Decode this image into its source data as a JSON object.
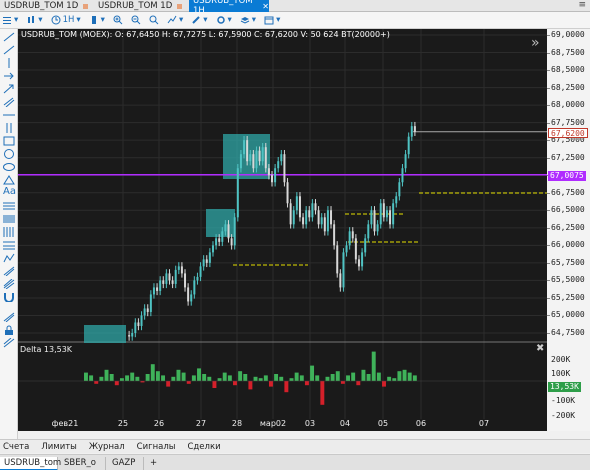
{
  "window_tabs": [
    {
      "label": "USDRUB_TOM 1D",
      "active": false
    },
    {
      "label": "USDRUB_TOM 1D",
      "active": false
    },
    {
      "label": "USDRUB_TOM 1H",
      "active": true
    }
  ],
  "toolbar": {
    "timeframe": "1H"
  },
  "chart": {
    "header": "USDRUB_TOM (MOEX): O: 67,6450 H: 67,7275 L: 67,5900 C: 67,6200 V: 50 624 BT(20000+)",
    "price_axis": [
      "69,0000",
      "68,7500",
      "68,5000",
      "68,2500",
      "68,0000",
      "67,7500",
      "67,5000",
      "67,2500",
      "67,0000",
      "66,7500",
      "66,5000",
      "66,2500",
      "66,0000",
      "65,7500",
      "65,5000",
      "65,2500",
      "65,0000",
      "64,7500"
    ],
    "last_price": "67,6200",
    "level_price": "67,0075",
    "delta_title": "Delta 13,53K",
    "delta_axis": [
      "200K",
      "100K",
      "-100K",
      "-200K"
    ],
    "delta_value": "13,53K",
    "x_labels": [
      "фев21",
      "25",
      "26",
      "27",
      "28",
      "мар02",
      "03",
      "04",
      "05",
      "06",
      "07"
    ]
  },
  "colors": {
    "up": "#4fc3c3",
    "down": "#d8d8d8",
    "level": "#b02cff",
    "dashed": "#e5e000",
    "box": "#2fa7a7",
    "delta_up": "#3fb25a",
    "delta_down": "#d4202a"
  },
  "bottom_tabs": [
    "Счета",
    "Лимиты",
    "Журнал",
    "Сигналы",
    "Сделки"
  ],
  "doc_tabs": [
    {
      "label": "USDRUB_tom",
      "active": true
    },
    {
      "label": "SBER_o",
      "active": false
    },
    {
      "label": "GAZP",
      "active": false
    },
    {
      "label": "+",
      "active": false
    }
  ]
}
